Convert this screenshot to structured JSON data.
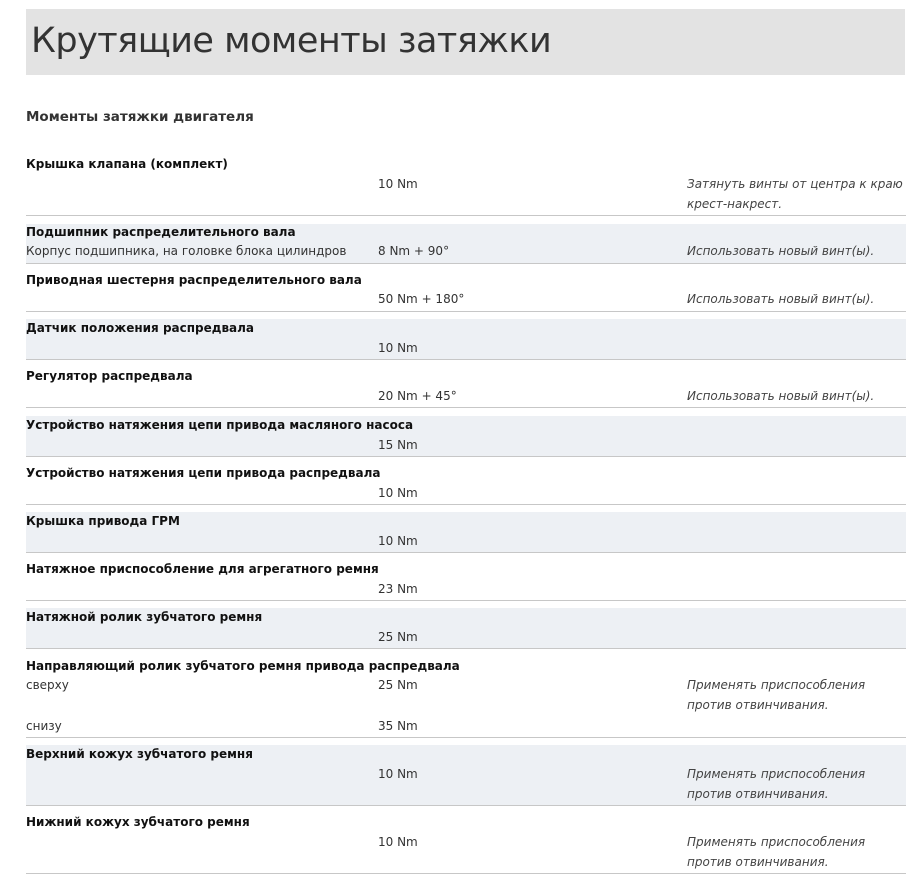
{
  "page_title": "Крутящие моменты затяжки",
  "section_title": "Моменты затяжки двигателя",
  "rows": [
    {
      "title": "Крышка клапана (комплект)",
      "entries": [
        {
          "desc": "",
          "value": "10 Nm",
          "note": "Затянуть винты от центра к краю крест-накрест."
        }
      ]
    },
    {
      "title": "Подшипник распределительного вала",
      "entries": [
        {
          "desc": "Корпус подшипника, на головке блока цилиндров",
          "value": "8 Nm + 90°",
          "note": "Использовать новый винт(ы)."
        }
      ]
    },
    {
      "title": "Приводная шестерня распределительного вала",
      "entries": [
        {
          "desc": "",
          "value": "50 Nm + 180°",
          "note": "Использовать новый винт(ы)."
        }
      ]
    },
    {
      "title": "Датчик положения распредвала",
      "entries": [
        {
          "desc": "",
          "value": "10 Nm",
          "note": ""
        }
      ]
    },
    {
      "title": "Регулятор распредвала",
      "entries": [
        {
          "desc": "",
          "value": "20 Nm + 45°",
          "note": "Использовать новый винт(ы)."
        }
      ]
    },
    {
      "title": "Устройство натяжения цепи привода масляного насоса",
      "entries": [
        {
          "desc": "",
          "value": "15 Nm",
          "note": ""
        }
      ]
    },
    {
      "title": "Устройство натяжения цепи привода распредвала",
      "entries": [
        {
          "desc": "",
          "value": "10 Nm",
          "note": ""
        }
      ]
    },
    {
      "title": "Крышка привода ГРМ",
      "entries": [
        {
          "desc": "",
          "value": "10 Nm",
          "note": ""
        }
      ]
    },
    {
      "title": "Натяжное приспособление для агрегатного ремня",
      "entries": [
        {
          "desc": "",
          "value": "23 Nm",
          "note": ""
        }
      ]
    },
    {
      "title": "Натяжной ролик зубчатого ремня",
      "entries": [
        {
          "desc": "",
          "value": "25 Nm",
          "note": ""
        }
      ]
    },
    {
      "title": "Направляющий ролик зубчатого ремня привода распредвала",
      "entries": [
        {
          "desc": "сверху",
          "value": "25 Nm",
          "note": "Применять приспособления против отвинчивания."
        },
        {
          "desc": "снизу",
          "value": "35 Nm",
          "note": ""
        }
      ]
    },
    {
      "title": "Верхний кожух зубчатого ремня",
      "entries": [
        {
          "desc": "",
          "value": "10 Nm",
          "note": "Применять приспособления против отвинчивания."
        }
      ]
    },
    {
      "title": "Нижний кожух зубчатого ремня",
      "entries": [
        {
          "desc": "",
          "value": "10 Nm",
          "note": "Применять приспособления против отвинчивания."
        }
      ]
    }
  ]
}
